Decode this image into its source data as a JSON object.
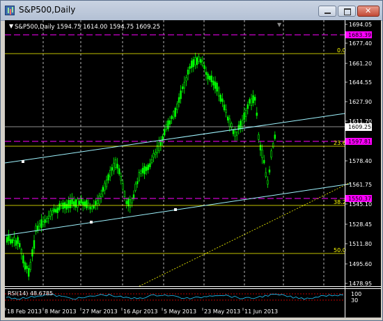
{
  "window": {
    "title": "S&P500,Daily"
  },
  "chart_header": {
    "text": "S&P500,Daily  1594.75 1614.00 1594.75 1609.25"
  },
  "price_axis": {
    "ticks": [
      "1694.05",
      "1677.40",
      "1661.20",
      "1644.55",
      "1627.90",
      "1611.70",
      "1594.60",
      "1578.40",
      "1561.75",
      "1545.10",
      "1528.45",
      "1511.80",
      "1495.60",
      "1478.95"
    ],
    "range": [
      1472,
      1700
    ]
  },
  "price_labels": {
    "current": "1609.25",
    "hline_top": "1683.39",
    "hline_mid": "1597.81",
    "hline_low": "1550.37"
  },
  "fib_levels": {
    "f0": "0.0",
    "f23": "23.6",
    "f38": "38.2",
    "f50": "50.0"
  },
  "date_axis": {
    "labels": [
      "18 Feb 2013",
      "8 Mar 2013",
      "27 Mar 2013",
      "16 Apr 2013",
      "5 May 2013",
      "23 May 2013",
      "11 Jun 2013"
    ]
  },
  "rsi": {
    "label": "RSI(14) 48.6785",
    "level_hi": "100",
    "level_lo": "30"
  },
  "colors": {
    "background": "#000000",
    "bull": "#00ff00",
    "grid": "#ffffff",
    "magenta": "#ff00ff",
    "fib": "#ffff00",
    "channel": "#9ff4ff",
    "rsi_line": "#1ec8ff",
    "rsi_levels": "#ff0000"
  }
}
